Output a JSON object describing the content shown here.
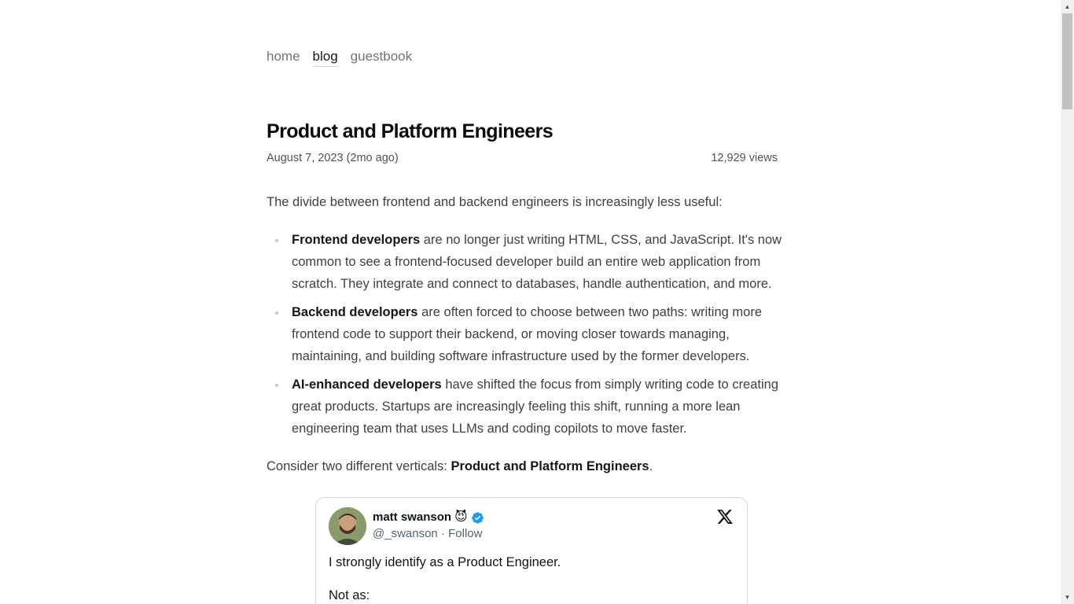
{
  "nav": {
    "items": [
      {
        "label": "home",
        "active": false
      },
      {
        "label": "blog",
        "active": true
      },
      {
        "label": "guestbook",
        "active": false
      }
    ]
  },
  "post": {
    "title": "Product and Platform Engineers",
    "date": "August 7, 2023 (2mo ago)",
    "views": "12,929 views",
    "intro": "The divide between frontend and backend engineers is increasingly less useful:",
    "bullets": [
      {
        "strong": "Frontend developers",
        "line1_rest": " are no longer just writing HTML, CSS, and JavaScript. It's now",
        "line2": "common to see a frontend-focused developer build an entire web application from",
        "line3": "scratch. They integrate and connect to databases, handle authentication, and more."
      },
      {
        "strong": "Backend developers",
        "line1_rest": " are often forced to choose between two paths: writing more",
        "line2": "frontend code to support their backend, or moving closer towards managing,",
        "line3": "maintaining, and building software infrastructure used by the former developers."
      },
      {
        "strong": "AI-enhanced developers",
        "line1_rest": " have shifted the focus from simply writing code to creating",
        "line2": "great products. Startups are increasingly feeling this shift, running a more lean",
        "line3": "engineering team that uses LLMs and coding copilots to move faster."
      }
    ],
    "consider_prefix": "Consider two different verticals: ",
    "consider_strong": "Product and Platform Engineers",
    "consider_suffix": "."
  },
  "tweet": {
    "name": "matt swanson",
    "emoji": "😈",
    "handle": "@_swanson",
    "separator": " · ",
    "follow": "Follow",
    "text_line1": "I strongly identify as a Product Engineer.",
    "text_line2": "Not as:"
  },
  "colors": {
    "verified_badge": "#1d9bf0",
    "tweet_border": "#cfd9de",
    "nav_active_underline": "#d4d4d4"
  }
}
